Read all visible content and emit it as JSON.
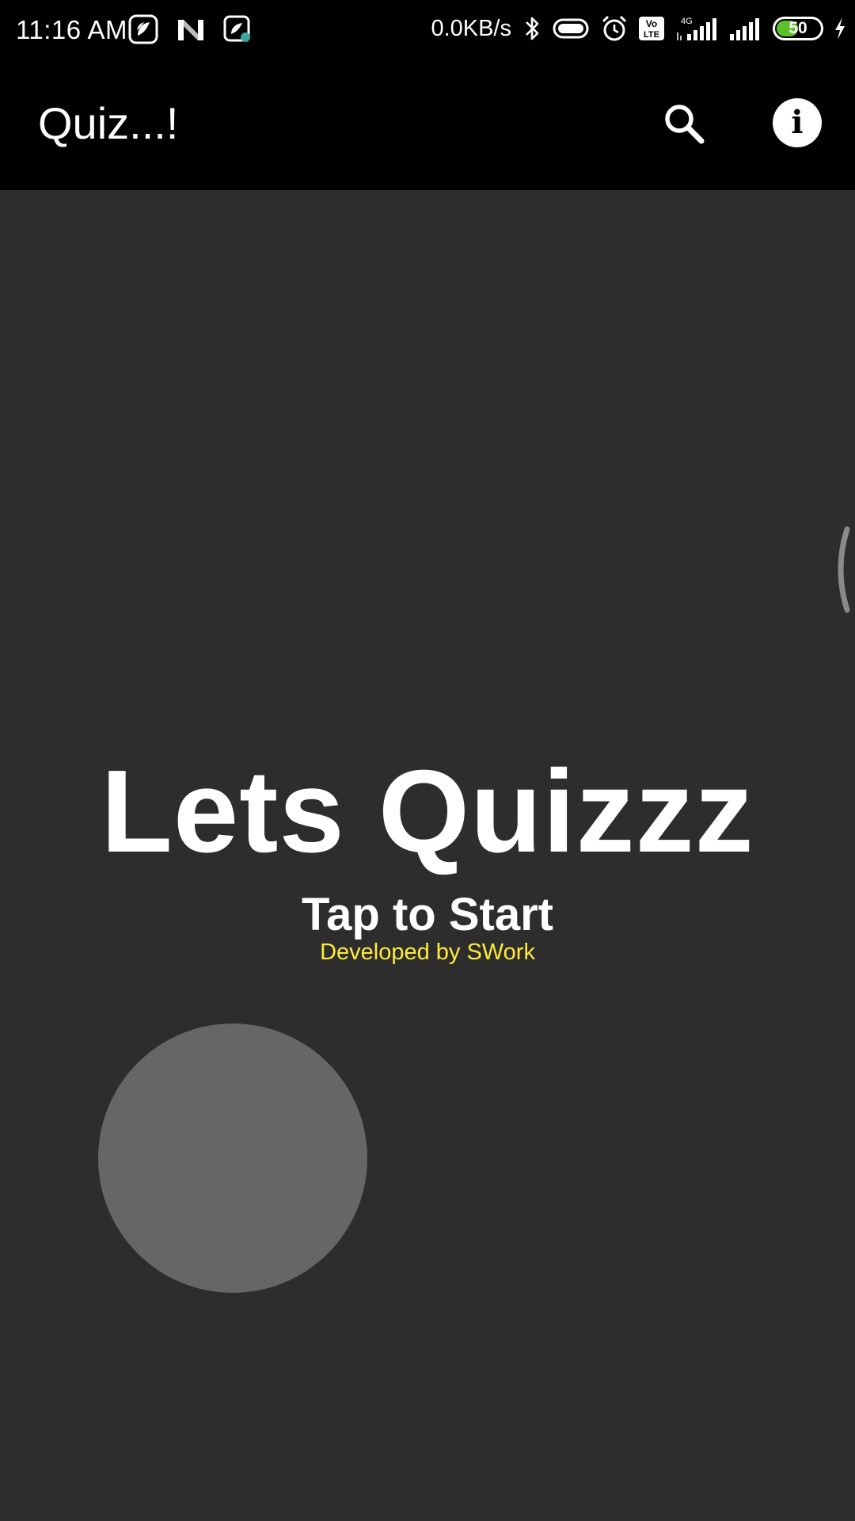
{
  "status_bar": {
    "time": "11:16 AM",
    "network_speed": "0.0KB/s",
    "network_type": "4G",
    "volte_label_top": "Vo",
    "volte_label_bottom": "LTE",
    "battery_level": "50",
    "battery_fraction": 0.5,
    "left_icons": [
      "saavn-icon",
      "n-app-icon",
      "saavn-download-icon"
    ],
    "right_icons": [
      "bluetooth-icon",
      "vibrate-icon",
      "alarm-icon",
      "volte-icon",
      "signal-icon",
      "signal-icon",
      "battery-icon",
      "charging-icon"
    ]
  },
  "app_bar": {
    "title": "Quiz...!",
    "actions": [
      "search-icon",
      "info-icon"
    ]
  },
  "main": {
    "headline": "Lets Quizzz",
    "tap_prompt": "Tap to Start",
    "credit": "Developed by SWork"
  },
  "colors": {
    "background": "#2d2d2d",
    "bars": "#000000",
    "credit": "#ffeb3b",
    "circle": "#666666",
    "battery": "#5cc02a"
  }
}
